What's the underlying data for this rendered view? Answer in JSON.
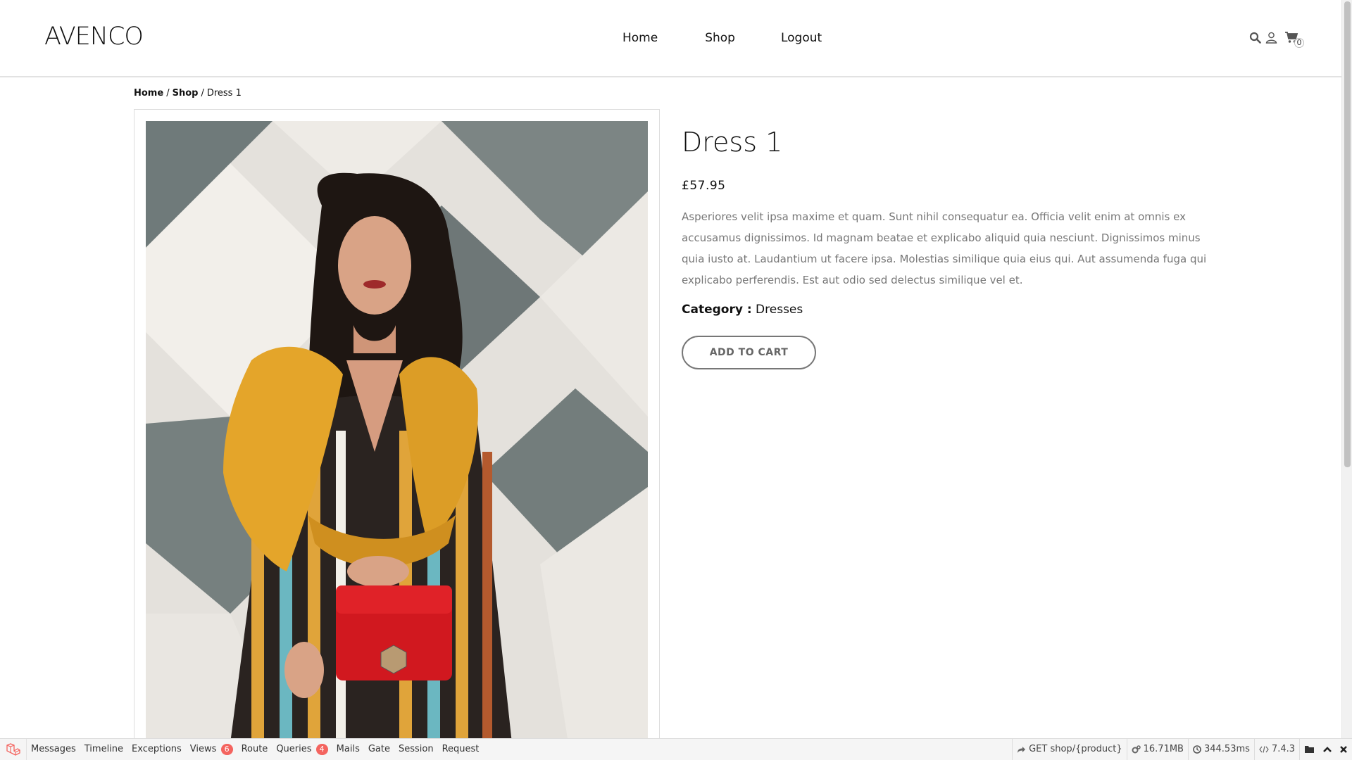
{
  "header": {
    "brand": "AVENCO",
    "nav": [
      "Home",
      "Shop",
      "Logout"
    ],
    "cart_count": "0"
  },
  "breadcrumb": {
    "home": "Home",
    "shop": "Shop",
    "current": "Dress 1",
    "separator": "/"
  },
  "product": {
    "title": "Dress 1",
    "price": "£57.95",
    "description": "Asperiores velit ipsa maxime et quam. Sunt nihil consequatur ea. Officia velit enim at omnis ex accusamus dignissimos. Id magnam beatae et explicabo aliquid quia nesciunt. Dignissimos minus quia iusto at. Laudantium ut facere ipsa. Molestias similique quia eius qui. Aut assumenda fuga qui explicabo perferendis. Est aut odio sed delectus similique vel et.",
    "category_label": "Category :",
    "category_value": "Dresses",
    "add_to_cart": "ADD TO CART"
  },
  "debugbar": {
    "tabs": [
      {
        "label": "Messages"
      },
      {
        "label": "Timeline"
      },
      {
        "label": "Exceptions"
      },
      {
        "label": "Views",
        "badge": "6"
      },
      {
        "label": "Route"
      },
      {
        "label": "Queries",
        "badge": "4"
      },
      {
        "label": "Mails"
      },
      {
        "label": "Gate"
      },
      {
        "label": "Session"
      },
      {
        "label": "Request"
      }
    ],
    "route": "GET shop/{product}",
    "memory": "16.71MB",
    "time": "344.53ms",
    "version": "7.4.3"
  },
  "colors": {
    "accent_badge": "#f4645f",
    "text": "#111111",
    "muted_text": "#777777"
  }
}
